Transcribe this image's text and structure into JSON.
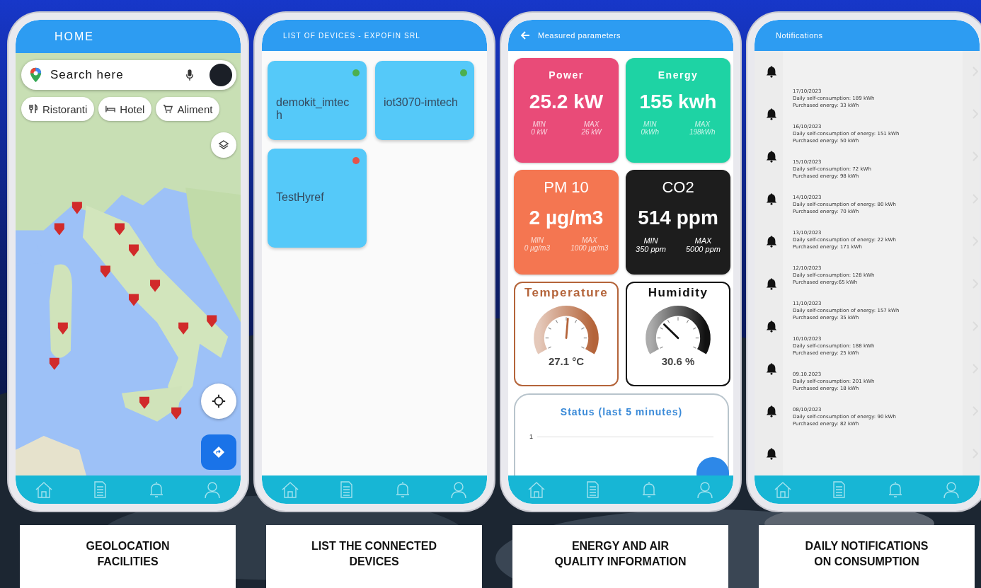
{
  "home_screen": {
    "title": "HOME",
    "search": {
      "placeholder": "Search here"
    },
    "chips": [
      {
        "label": "Ristoranti",
        "kind": "restaurant"
      },
      {
        "label": "Hotel",
        "kind": "hotel"
      },
      {
        "label": "Aliment",
        "kind": "shop"
      }
    ]
  },
  "devices_screen": {
    "title": "LIST OF DEVICES - EXPOFIN SRL",
    "devices": [
      {
        "name": "demokit_imtech",
        "color": "#4caf50"
      },
      {
        "name": "iot3070-imtech",
        "color": "#4caf50"
      },
      {
        "name": "TestHyref",
        "color": "#e5534b"
      }
    ]
  },
  "parameters_screen": {
    "title": "Measured parameters",
    "metrics": [
      {
        "label": "Power",
        "value": "25.2 kW",
        "min_label": "MIN",
        "min": "0 kW",
        "max_label": "MAX",
        "max": "26 kW",
        "color": "#e94b78"
      },
      {
        "label": "Energy",
        "value": "155 kwh",
        "min_label": "MIN",
        "min": "0kWh",
        "max_label": "MAX",
        "max": "198kWh",
        "color": "#1ed3a4"
      },
      {
        "label": "PM 10",
        "value": "2 µg/m3",
        "min_label": "MIN",
        "min": "0 µg/m3",
        "max_label": "MAX",
        "max": "1000 µg/m3",
        "color": "#f47651"
      },
      {
        "label": "CO2",
        "value": "514 ppm",
        "min_label": "MIN",
        "min": "350 ppm",
        "max_label": "MAX",
        "max": "5000 ppm",
        "color": "#1d1d1d"
      }
    ],
    "gauges": [
      {
        "label": "Temperature",
        "reading": "27.1 °C",
        "level": 0.52,
        "color": "#b4643a"
      },
      {
        "label": "Humidity",
        "reading": "30.6 %",
        "level": 0.31,
        "color": "#111111"
      }
    ],
    "status": {
      "title": "Status (last 5 minutes)",
      "y_tick": "1"
    }
  },
  "notifications_screen": {
    "title": "Notifications",
    "items": [
      {
        "date": "17/10/2023",
        "consumption": "Daily self-consumption: 189 kWh",
        "purchased": "Purchased energy: 33 kWh"
      },
      {
        "date": "16/10/2023",
        "consumption": "Daily self-consumption of energy: 151 kWh",
        "purchased": "Purchased energy: 50 kWh"
      },
      {
        "date": "15/10/2023",
        "consumption": "Daily self-consumption: 72 kWh",
        "purchased": "Purchased energy: 98 kWh"
      },
      {
        "date": "14/10/2023",
        "consumption": "Daily self-consumption of energy: 80 kWh",
        "purchased": "Purchased energy: 70 kWh"
      },
      {
        "date": "13/10/2023",
        "consumption": "Daily self-consumption of energy: 22 kWh",
        "purchased": "Purchased energy: 171 kWh"
      },
      {
        "date": "12/10/2023",
        "consumption": "Daily self-consumption: 128 kWh",
        "purchased": "Purchased energy:65 kWh"
      },
      {
        "date": "11/10/2023",
        "consumption": "Daily self-consumption of energy: 157 kWh",
        "purchased": "Purchased energy: 35 kWh"
      },
      {
        "date": "10/10/2023",
        "consumption": "Daily self-consumption: 188 kWh",
        "purchased": "Purchased energy: 25 kWh"
      },
      {
        "date": "09.10.2023",
        "consumption": "Daily self-consumption: 201 kWh",
        "purchased": "Purchased energy: 18 kWh"
      },
      {
        "date": "08/10/2023",
        "consumption": "Daily self-consumption of energy: 90 kWh",
        "purchased": "Purchased energy: 82 kWh"
      }
    ]
  },
  "captions": [
    {
      "lines": [
        "GEOLOCATION",
        "FACILITIES"
      ]
    },
    {
      "lines": [
        "LIST THE CONNECTED",
        "DEVICES"
      ]
    },
    {
      "lines": [
        "ENERGY AND AIR",
        "QUALITY INFORMATION"
      ]
    },
    {
      "lines": [
        "DAILY NOTIFICATIONS",
        "ON CONSUMPTION"
      ]
    }
  ]
}
